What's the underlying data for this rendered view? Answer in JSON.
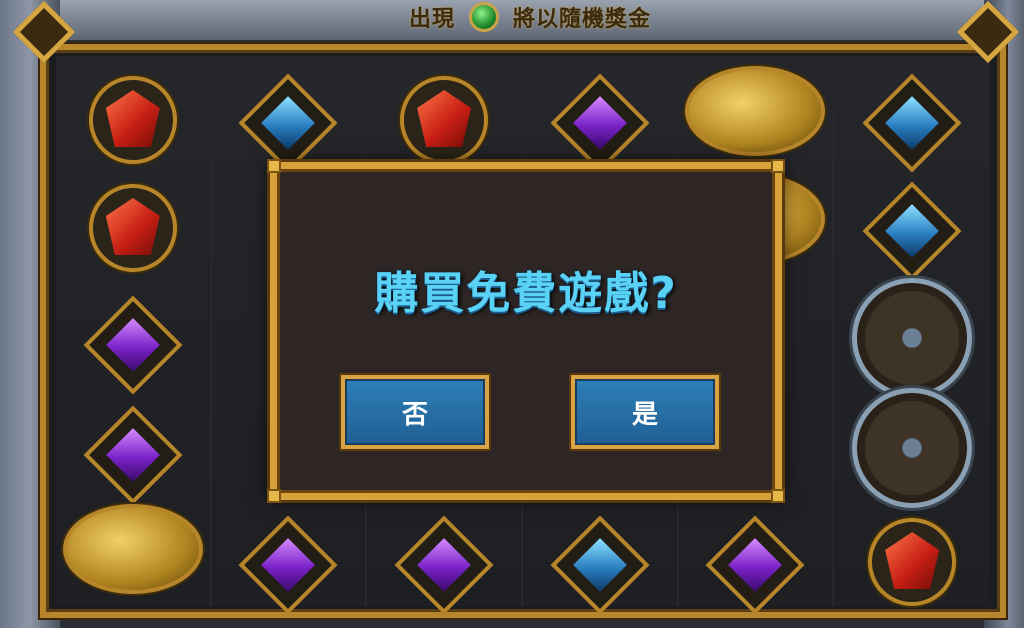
{
  "header": {
    "left_text": "出現",
    "right_text": "將以隨機獎金",
    "orb_icon": "green-orb-icon"
  },
  "dialog": {
    "title": "購買免費遊戲?",
    "no_label": "否",
    "yes_label": "是"
  },
  "reels": [
    [
      "red-gem",
      "red-gem",
      "purple-gem",
      "purple-gem",
      "gold-coins"
    ],
    [
      "blue-gem",
      "hidden",
      "hidden",
      "hidden",
      "purple-gem"
    ],
    [
      "red-gem",
      "hidden",
      "hidden",
      "hidden",
      "purple-gem"
    ],
    [
      "purple-gem",
      "hidden",
      "hidden",
      "hidden",
      "blue-gem"
    ],
    [
      "gold-coins",
      "gold-coins",
      "hidden",
      "hidden",
      "purple-gem"
    ],
    [
      "blue-gem",
      "blue-gem",
      "shield",
      "shield",
      "red-gem"
    ]
  ],
  "colors": {
    "frame_gold": "#d7a23a",
    "title_blue": "#5ad2f6",
    "button_blue": "#2f7fb8"
  }
}
